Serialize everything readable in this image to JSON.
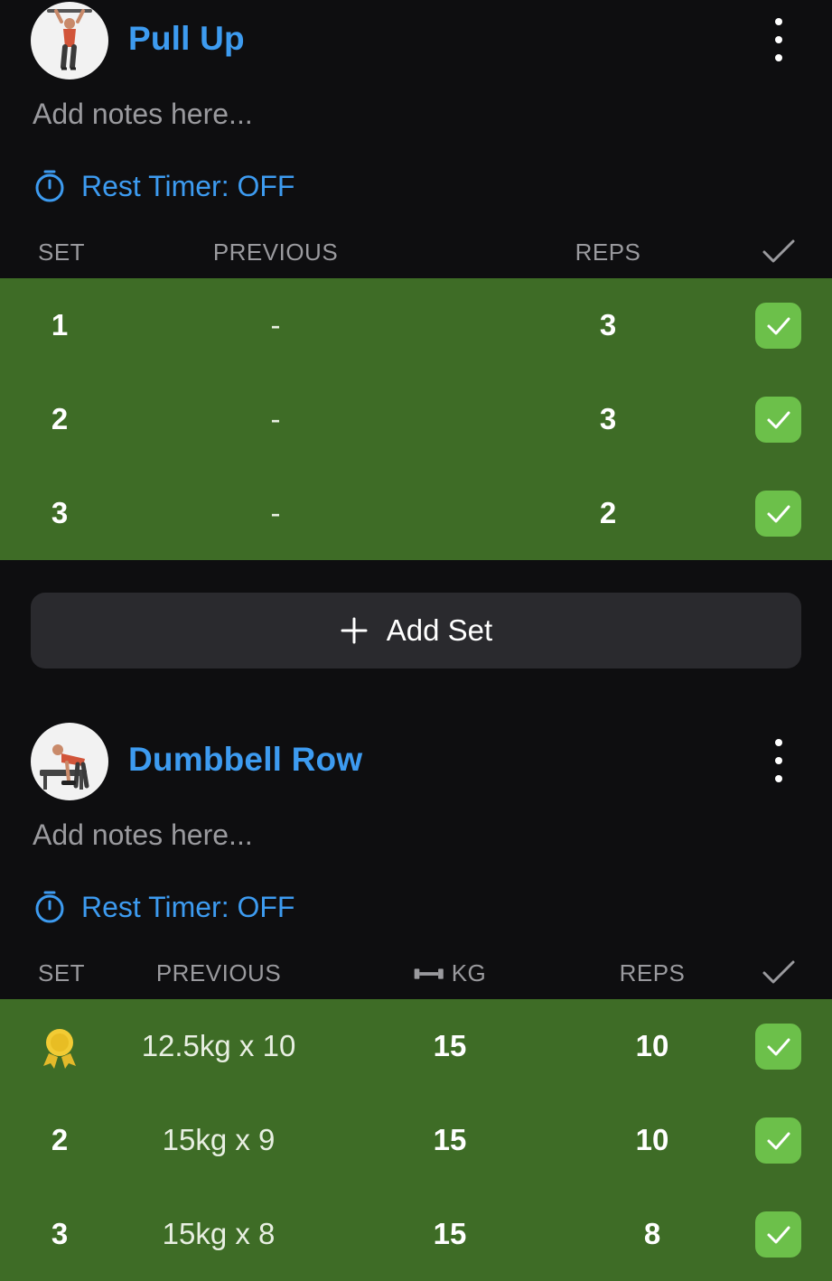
{
  "colors": {
    "accent": "#3d9bf0",
    "completed_row": "#3e6c26",
    "check_green": "#6cc04a",
    "background": "#0e0e10",
    "button_bg": "#2a2a2e"
  },
  "exercises": [
    {
      "name": "Pull Up",
      "image_icon": "pull-up-figure",
      "notes_placeholder": "Add notes here...",
      "rest_timer": "Rest Timer: OFF",
      "columns": {
        "set": "SET",
        "previous": "PREVIOUS",
        "reps": "REPS"
      },
      "sets": [
        {
          "set": "1",
          "previous": "-",
          "reps": "3",
          "completed": true
        },
        {
          "set": "2",
          "previous": "-",
          "reps": "3",
          "completed": true
        },
        {
          "set": "3",
          "previous": "-",
          "reps": "2",
          "completed": true
        }
      ],
      "add_set_label": "Add Set"
    },
    {
      "name": "Dumbbell Row",
      "image_icon": "dumbbell-row-figure",
      "notes_placeholder": "Add notes here...",
      "rest_timer": "Rest Timer: OFF",
      "columns": {
        "set": "SET",
        "previous": "PREVIOUS",
        "kg": "KG",
        "reps": "REPS"
      },
      "sets": [
        {
          "set": "medal-icon",
          "previous": "12.5kg x 10",
          "kg": "15",
          "reps": "10",
          "completed": true
        },
        {
          "set": "2",
          "previous": "15kg x 9",
          "kg": "15",
          "reps": "10",
          "completed": true
        },
        {
          "set": "3",
          "previous": "15kg x 8",
          "kg": "15",
          "reps": "8",
          "completed": true
        }
      ]
    }
  ]
}
